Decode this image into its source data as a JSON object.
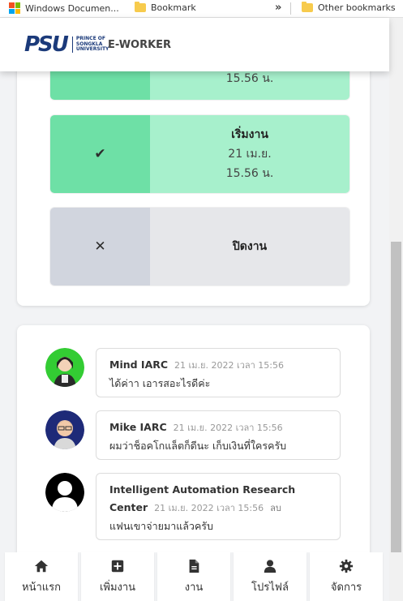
{
  "browser": {
    "bookmarks": [
      {
        "label": "Windows Documen...",
        "icon": "windows-logo-icon"
      },
      {
        "label": "Bookmark",
        "icon": "folder-icon"
      },
      {
        "label": "Other bookmarks",
        "icon": "folder-icon"
      }
    ],
    "overflow_chevron": "»"
  },
  "header": {
    "logo_text": "PSU",
    "logo_subtext": [
      "PRINCE OF",
      "SONGKLA",
      "UNIVERSITY"
    ],
    "app_title": "E-WORKER"
  },
  "status_steps": [
    {
      "icon": "check-icon",
      "icon_glyph": "",
      "title": "",
      "date": "",
      "time": "15.56 น.",
      "state": "done"
    },
    {
      "icon": "check-icon",
      "icon_glyph": "✔",
      "title": "เริ่มงาน",
      "date": "21 เม.ย.",
      "time": "15.56 น.",
      "state": "done"
    },
    {
      "icon": "close-icon",
      "icon_glyph": "✕",
      "title": "ปิดงาน",
      "date": "",
      "time": "",
      "state": "pending"
    }
  ],
  "comments": [
    {
      "name": "Mind IARC",
      "time": "21 เม.ย. 2022 เวลา 15:56",
      "text": "ได้ค่าา เอารสอะไรดีค่ะ",
      "avatar": "avatar-woman-icon"
    },
    {
      "name": "Mike IARC",
      "time": "21 เม.ย. 2022 เวลา 15:56",
      "text": "ผมว่าช็อคโกแล็ตก็ดีนะ เก็บเงินที่ใครครับ",
      "avatar": "avatar-man-icon"
    },
    {
      "name": "Intelligent Automation Research",
      "name_line2": "Center",
      "time": "21 เม.ย. 2022 เวลา 15:56",
      "extra": "ลบ",
      "text": "แฟนเขาจ่ายมาแล้วครับ",
      "avatar": "avatar-default-icon"
    }
  ],
  "bottom_nav": [
    {
      "label": "หน้าแรก",
      "icon": "home-icon"
    },
    {
      "label": "เพิ่มงาน",
      "icon": "plus-square-icon"
    },
    {
      "label": "งาน",
      "icon": "document-icon"
    },
    {
      "label": "โปรไฟล์",
      "icon": "user-icon"
    },
    {
      "label": "จัดการ",
      "icon": "gear-icon"
    }
  ],
  "colors": {
    "done_icon_bg": "#6ee0a6",
    "done_body_bg": "#a7f0cc",
    "pending_icon_bg": "#d1d5de",
    "pending_body_bg": "#e6e7ea",
    "brand": "#1b3a7a"
  }
}
